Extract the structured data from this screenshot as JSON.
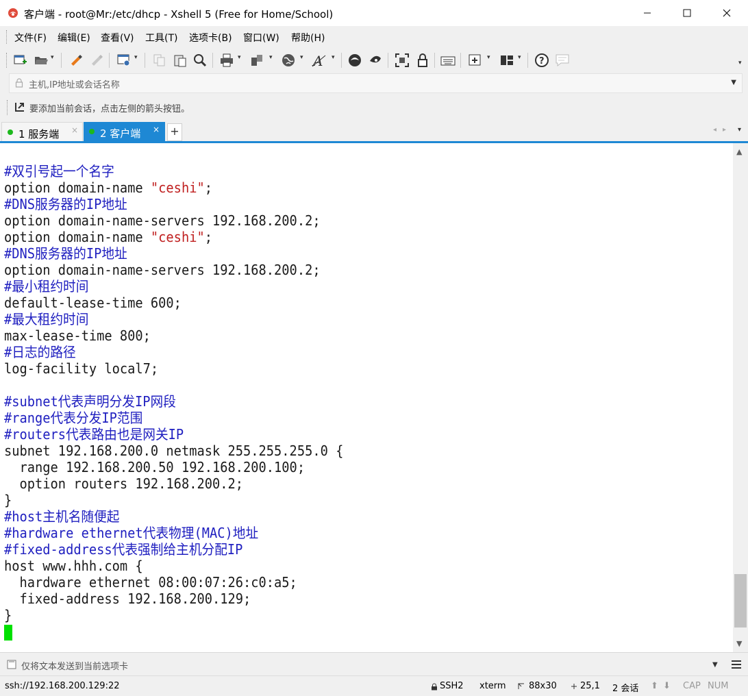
{
  "window": {
    "title": "客户端 - root@Mr:/etc/dhcp - Xshell 5 (Free for Home/School)",
    "minimize": "—",
    "maximize": "☐",
    "close": "✕"
  },
  "menubar": {
    "items": [
      "文件(F)",
      "编辑(E)",
      "查看(V)",
      "工具(T)",
      "选项卡(B)",
      "窗口(W)",
      "帮助(H)"
    ]
  },
  "toolbar": {
    "icons": [
      "new-session-icon",
      "open-folder-icon",
      "reconnect-icon",
      "disconnect-icon",
      "properties-icon",
      "copy-icon",
      "paste-icon",
      "find-icon",
      "print-icon",
      "transfer-icon",
      "globe-icon",
      "font-icon",
      "xftp-icon",
      "xagent-icon",
      "fullscreen-icon",
      "lock-icon",
      "keyboard-icon",
      "add-tab-icon",
      "layout-icon",
      "help-icon",
      "chat-icon"
    ]
  },
  "address": {
    "placeholder": "主机,IP地址或会话名称"
  },
  "hint": {
    "text": "要添加当前会话，点击左侧的箭头按钮。"
  },
  "tabs": [
    {
      "label": "1 服务端",
      "active": false,
      "status_color": "#1cb81c"
    },
    {
      "label": "2 客户端",
      "active": true,
      "status_color": "#1cb81c"
    }
  ],
  "tab_add": "+",
  "terminal": {
    "lines": [
      [
        {
          "t": "#双引号起一个名字",
          "c": "comment"
        }
      ],
      [
        {
          "t": "option domain-name "
        },
        {
          "t": "\"ceshi\"",
          "c": "string"
        },
        {
          "t": ";"
        }
      ],
      [
        {
          "t": "#DNS服务器的IP地址",
          "c": "comment"
        }
      ],
      [
        {
          "t": "option domain-name-servers 192.168.200.2;"
        }
      ],
      [
        {
          "t": "option domain-name "
        },
        {
          "t": "\"ceshi\"",
          "c": "string"
        },
        {
          "t": ";"
        }
      ],
      [
        {
          "t": "#DNS服务器的IP地址",
          "c": "comment"
        }
      ],
      [
        {
          "t": "option domain-name-servers 192.168.200.2;"
        }
      ],
      [
        {
          "t": "#最小租约时间",
          "c": "comment"
        }
      ],
      [
        {
          "t": "default-lease-time 600;"
        }
      ],
      [
        {
          "t": "#最大租约时间",
          "c": "comment"
        }
      ],
      [
        {
          "t": "max-lease-time 800;"
        }
      ],
      [
        {
          "t": "#日志的路径",
          "c": "comment"
        }
      ],
      [
        {
          "t": "log-facility local7;"
        }
      ],
      [
        {
          "t": ""
        }
      ],
      [
        {
          "t": "#subnet代表声明分发IP网段",
          "c": "comment"
        }
      ],
      [
        {
          "t": "#range代表分发IP范围",
          "c": "comment"
        }
      ],
      [
        {
          "t": "#routers代表路由也是网关IP",
          "c": "comment"
        }
      ],
      [
        {
          "t": "subnet 192.168.200.0 netmask 255.255.255.0 {"
        }
      ],
      [
        {
          "t": "  range 192.168.200.50 192.168.200.100;"
        }
      ],
      [
        {
          "t": "  option routers 192.168.200.2;"
        }
      ],
      [
        {
          "t": "}"
        }
      ],
      [
        {
          "t": "#host主机名随便起",
          "c": "comment"
        }
      ],
      [
        {
          "t": "#hardware ethernet代表物理(MAC)地址",
          "c": "comment"
        }
      ],
      [
        {
          "t": "#fixed-address代表强制给主机分配IP",
          "c": "comment"
        }
      ],
      [
        {
          "t": "host www.hhh.com {"
        }
      ],
      [
        {
          "t": "  hardware ethernet 08:00:07:26:c0:a5;"
        }
      ],
      [
        {
          "t": "  fixed-address 192.168.200.129;"
        }
      ],
      [
        {
          "t": "}"
        }
      ]
    ],
    "cursor_color": "#00e000"
  },
  "sendbar": {
    "placeholder": "仅将文本发送到当前选项卡"
  },
  "status": {
    "connection": "ssh://192.168.200.129:22",
    "protocol": "SSH2",
    "terminal_type": "xterm",
    "size": "88x30",
    "cursor_pos": "25,1",
    "sessions": "2 会话",
    "caps": "CAP",
    "num": "NUM"
  },
  "colors": {
    "accent": "#1e88d4",
    "comment": "#2020c0",
    "string": "#c02020",
    "status_dot": "#1cb81c"
  }
}
